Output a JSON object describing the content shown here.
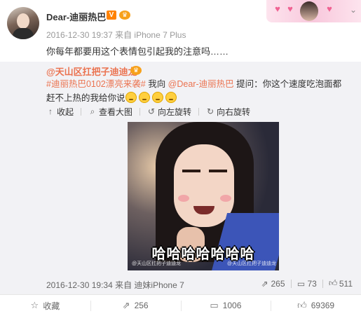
{
  "post": {
    "username": "Dear-迪丽热巴",
    "vip_badge": "V",
    "meta": "2016-12-30 19:37 来自 iPhone 7 Plus",
    "text": "你每年都要用这个表情包引起我的注意吗……",
    "level_badge_icon": "crown-icon"
  },
  "repost": {
    "username": "@天山区扛把子迪迪龙",
    "tag": "#迪丽热巴0102漂亮来袭#",
    "text_1": " 我向 ",
    "mention": "@Dear-迪丽热巴",
    "text_2": " 提问：你这个速度吃泡面都赶不上热的我给你说",
    "emoji_count": 4,
    "image_tools": {
      "collapse": "收起",
      "view_large": "查看大图",
      "rotate_left": "向左旋转",
      "rotate_right": "向右旋转"
    },
    "image": {
      "caption": "哈哈哈哈哈哈哈",
      "watermark_left": "@天山区扛把子迪迪龙",
      "watermark_right": "@天山区扛把子迪迪龙"
    },
    "meta": "2016-12-30 19:34 来自 迪妹iPhone 7",
    "repost_count": "265",
    "comment_count": "73",
    "like_count": "511"
  },
  "actions": {
    "favorite": "收藏",
    "repost": "256",
    "comment": "1006",
    "like": "69369"
  },
  "colors": {
    "accent": "#eb7350",
    "repost_bg": "#f2f2f5",
    "vip": "#ff8200"
  }
}
